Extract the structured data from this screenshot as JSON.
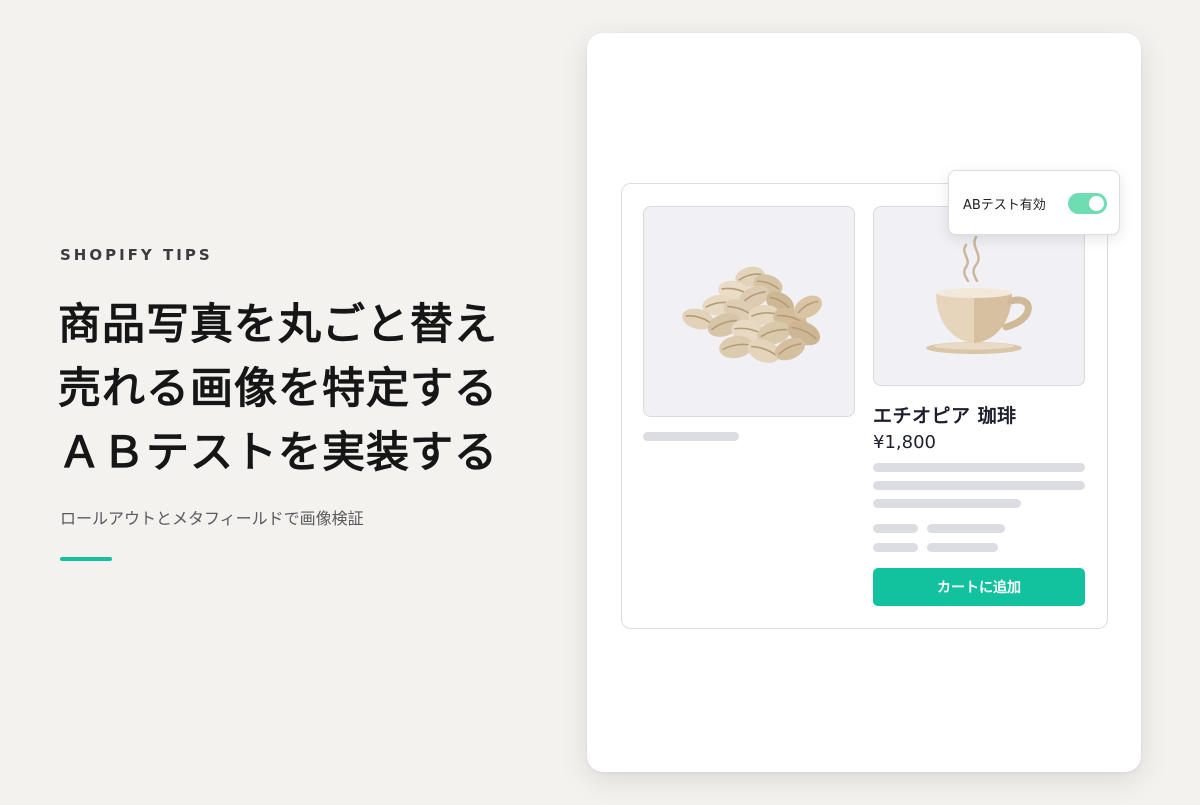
{
  "hero": {
    "eyebrow": "SHOPIFY TIPS",
    "headline_lines": [
      "商品写真を丸ごと替え",
      "売れる画像を特定する",
      "ＡＢテストを実装する"
    ],
    "subtitle": "ロールアウトとメタフィールドで画像検証"
  },
  "product": {
    "title": "エチオピア 珈琲",
    "price": "¥1,800",
    "add_to_cart_label": "カートに追加",
    "variant_a_image": "coffee-beans-icon",
    "variant_b_image": "coffee-cup-icon"
  },
  "ab_toggle": {
    "label": "ABテスト有効",
    "enabled": true
  },
  "colors": {
    "background": "#f3f2ef",
    "accent": "#15c19f",
    "button": "#12c19e",
    "toggle_on": "#6fdcb1"
  }
}
